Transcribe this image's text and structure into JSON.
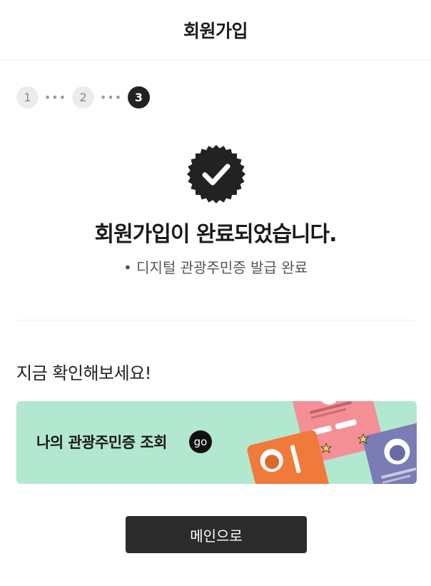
{
  "header": {
    "title": "회원가입"
  },
  "steps": {
    "items": [
      "1",
      "2",
      "3"
    ],
    "separator": "•••",
    "active_index": 2
  },
  "completion": {
    "badge_icon": "check-badge-icon",
    "title": "회원가입이 완료되었습니다.",
    "subtitle": "• 디지털 관광주민증 발급 완료"
  },
  "section": {
    "title": "지금 확인해보세요!"
  },
  "banner": {
    "text": "나의 관광주민증 조회",
    "go_label": "go",
    "background": "#b2e8cf"
  },
  "main_button": {
    "label": "메인으로"
  },
  "colors": {
    "accent_dark": "#222222",
    "step_inactive": "#ececec",
    "banner_bg": "#b2e8cf"
  }
}
